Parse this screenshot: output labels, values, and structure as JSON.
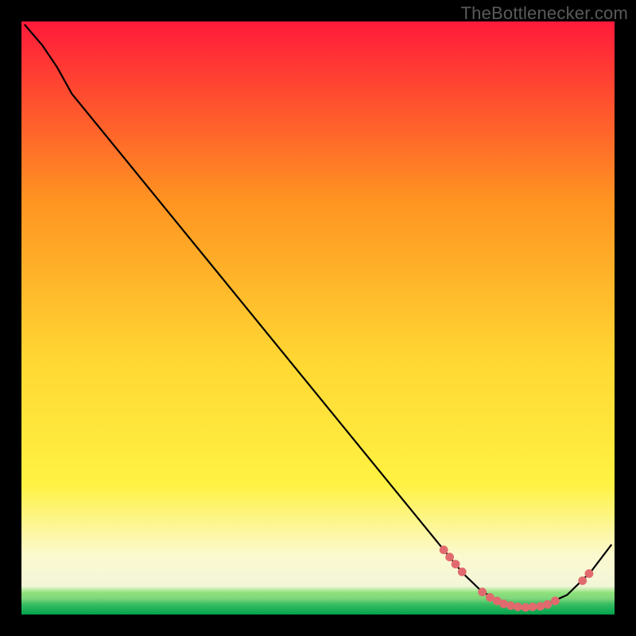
{
  "watermark": "TheBottlenecker.com",
  "colors": {
    "gradient_start": "#ff1a3a",
    "gradient_mid_orange": "#ff9321",
    "gradient_mid_yellow_top": "#ffd733",
    "gradient_mid_yellow_bottom": "#fff242",
    "gradient_lightyellow": "#fbf9cf",
    "gradient_green_light": "#8fe27c",
    "gradient_green_dark": "#02a14b",
    "curve": "#000000",
    "dot": "#e16a6e",
    "background": "#000000"
  },
  "chart_data": {
    "type": "line",
    "title": "",
    "xlabel": "",
    "ylabel": "",
    "x_range": [
      0,
      100
    ],
    "y_range": [
      0,
      100
    ],
    "curve": [
      {
        "x": 0.5,
        "y": 99.5
      },
      {
        "x": 3.5,
        "y": 96.0
      },
      {
        "x": 6.0,
        "y": 92.3
      },
      {
        "x": 8.5,
        "y": 87.8
      },
      {
        "x": 73.0,
        "y": 8.7
      },
      {
        "x": 74.5,
        "y": 6.9
      },
      {
        "x": 77.5,
        "y": 4.0
      },
      {
        "x": 81.0,
        "y": 2.0
      },
      {
        "x": 84.0,
        "y": 1.2
      },
      {
        "x": 88.0,
        "y": 1.5
      },
      {
        "x": 92.0,
        "y": 3.3
      },
      {
        "x": 96.0,
        "y": 7.2
      },
      {
        "x": 99.5,
        "y": 11.8
      }
    ],
    "highlight_points": [
      {
        "x": 71.2,
        "y": 10.9
      },
      {
        "x": 72.2,
        "y": 9.7
      },
      {
        "x": 73.2,
        "y": 8.5
      },
      {
        "x": 74.3,
        "y": 7.2
      },
      {
        "x": 77.7,
        "y": 3.8
      },
      {
        "x": 79.0,
        "y": 2.9
      },
      {
        "x": 80.2,
        "y": 2.3
      },
      {
        "x": 81.3,
        "y": 1.8
      },
      {
        "x": 82.5,
        "y": 1.5
      },
      {
        "x": 83.7,
        "y": 1.3
      },
      {
        "x": 85.0,
        "y": 1.2
      },
      {
        "x": 86.2,
        "y": 1.3
      },
      {
        "x": 87.5,
        "y": 1.4
      },
      {
        "x": 88.7,
        "y": 1.7
      },
      {
        "x": 90.0,
        "y": 2.3
      },
      {
        "x": 94.6,
        "y": 5.7
      },
      {
        "x": 95.7,
        "y": 6.9
      }
    ]
  }
}
